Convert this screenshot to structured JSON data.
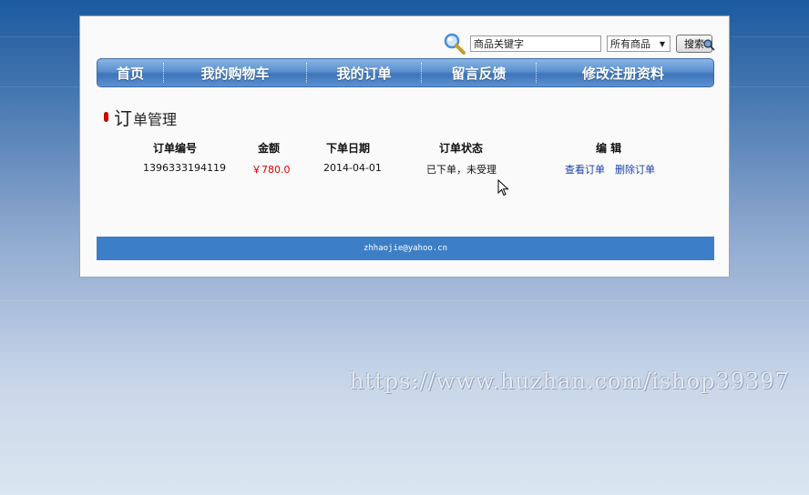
{
  "search": {
    "value": "商品关键字",
    "category_selected": "所有商品",
    "button_label": "搜索"
  },
  "nav": {
    "items": [
      {
        "label": "首页"
      },
      {
        "label": "我的购物车"
      },
      {
        "label": "我的订单"
      },
      {
        "label": "留言反馈"
      },
      {
        "label": "修改注册资料"
      }
    ]
  },
  "section": {
    "title_first": "订",
    "title_rest": "单管理"
  },
  "orders": {
    "headers": {
      "number": "订单编号",
      "amount": "金额",
      "date": "下单日期",
      "status": "订单状态",
      "edit": "编 辑"
    },
    "rows": [
      {
        "number": "1396333194119",
        "amount": "￥780.0",
        "date": "2014-04-01",
        "status": "已下单，未受理",
        "view_label": "查看订单",
        "delete_label": "删除订单"
      }
    ]
  },
  "footer": {
    "email": "zhhaojie@yahoo.cn"
  },
  "watermark": {
    "text": "https://www.huzhan.com/ishop39397"
  },
  "colors": {
    "nav": "#5a8fce",
    "footer": "#3d7fc6",
    "amount": "#e00000",
    "link": "#1a3fa8"
  }
}
